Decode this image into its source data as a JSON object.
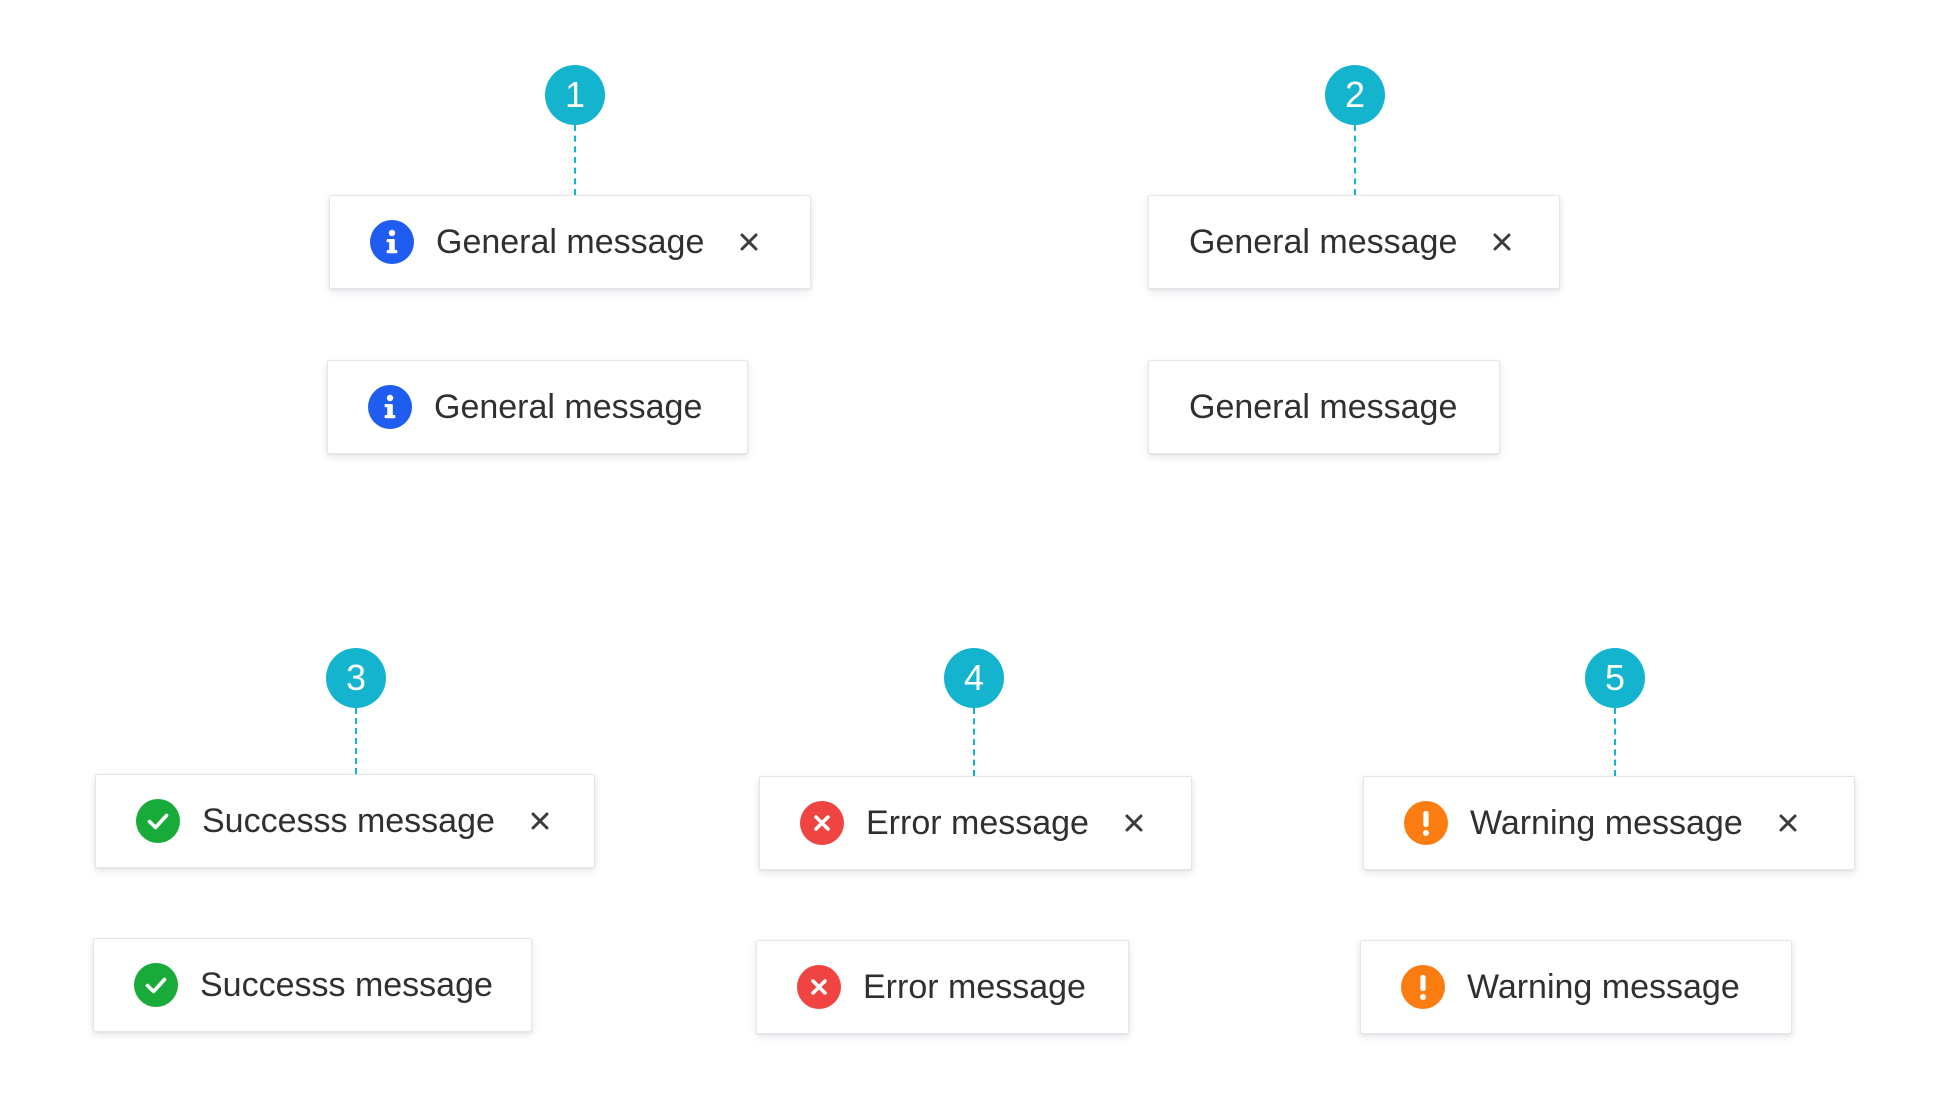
{
  "markers": [
    "1",
    "2",
    "3",
    "4",
    "5"
  ],
  "colors": {
    "marker": "#14b4cf",
    "info": "#1f5cf0",
    "success": "#18ab3a",
    "error": "#ef4442",
    "warning": "#fb7d12",
    "text": "#2f3033",
    "close": "#3a3c40"
  },
  "groups": [
    {
      "marker": "1",
      "variants": [
        {
          "type": "info",
          "icon": "info-icon",
          "message": "General message",
          "dismissible": true
        },
        {
          "type": "info",
          "icon": "info-icon",
          "message": "General message",
          "dismissible": false
        }
      ]
    },
    {
      "marker": "2",
      "variants": [
        {
          "type": "plain",
          "icon": "",
          "message": "General message",
          "dismissible": true
        },
        {
          "type": "plain",
          "icon": "",
          "message": "General message",
          "dismissible": false
        }
      ]
    },
    {
      "marker": "3",
      "variants": [
        {
          "type": "success",
          "icon": "check-icon",
          "message": "Successs message",
          "dismissible": true
        },
        {
          "type": "success",
          "icon": "check-icon",
          "message": "Successs message",
          "dismissible": false
        }
      ]
    },
    {
      "marker": "4",
      "variants": [
        {
          "type": "error",
          "icon": "x-circle-icon",
          "message": "Error message",
          "dismissible": true
        },
        {
          "type": "error",
          "icon": "x-circle-icon",
          "message": "Error message",
          "dismissible": false
        }
      ]
    },
    {
      "marker": "5",
      "variants": [
        {
          "type": "warning",
          "icon": "exclamation-icon",
          "message": "Warning message",
          "dismissible": true
        },
        {
          "type": "warning",
          "icon": "exclamation-icon",
          "message": "Warning message",
          "dismissible": false
        }
      ]
    }
  ]
}
